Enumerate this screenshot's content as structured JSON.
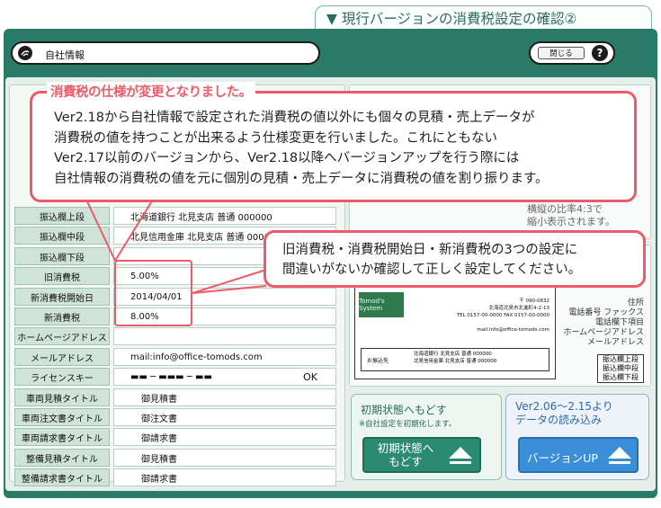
{
  "banner": {
    "title": "▼ 現行バージョンの消費税設定の確認②"
  },
  "window": {
    "title": "自社情報",
    "close_label": "閉じる",
    "help_label": "?"
  },
  "callout_top": {
    "heading": "消費税の仕様が変更となりました。",
    "body": [
      "Ver2.18から自社情報で設定された消費税の値以外にも個々の見積・売上データが",
      "消費税の値を持つことが出来るよう仕様変更を行いました。これにともない",
      "Ver2.17以前のバージョンから、Ver2.18以降へバージョンアップを行う際には",
      "自社情報の消費税の値を元に個別の見積・売上データに消費税の値を割り振ります。"
    ]
  },
  "callout_mid": {
    "body": [
      "旧消費税・消費税開始日・新消費税の3つの設定に",
      "間違いがないか確認して正しく設定してください。"
    ]
  },
  "preview_note": [
    "横縦の比率4:3で",
    "縮小表示されます。"
  ],
  "rows": [
    {
      "label": "振込欄上段",
      "value": "北海道銀行  北見支店  普通  000000"
    },
    {
      "label": "振込欄中段",
      "value": "北見信用金庫  北見支店  普通  000000"
    },
    {
      "label": "振込欄下段",
      "value": ""
    },
    {
      "label": "旧消費税",
      "value": "5.00%"
    },
    {
      "label": "新消費税開始日",
      "value": "2014/04/01"
    },
    {
      "label": "新消費税",
      "value": "8.00%"
    },
    {
      "label": "ホームページアドレス",
      "value": ""
    },
    {
      "label": "メールアドレス",
      "value": "mail:info@office-tomods.com"
    },
    {
      "label": "ライセンスキー",
      "value": "▬▬  ─  ▬▬▬  ─  ▬▬",
      "status": "OK"
    },
    {
      "label": "車両見積タイトル",
      "value": "御見積書"
    },
    {
      "label": "車両注文書タイトル",
      "value": "御注文書"
    },
    {
      "label": "車両請求書タイトル",
      "value": "御請求書"
    },
    {
      "label": "整備見積タイトル",
      "value": "御見積書"
    },
    {
      "label": "整備請求書タイトル",
      "value": "御請求書"
    }
  ],
  "preview": {
    "logo": "Tomod's System",
    "address_lines": [
      "〒 090-0832",
      "北海道北見市北進町4-2-13",
      "TEL 0157-00-0000  FAX 0157-00-0000",
      "mail:info@office-tomods.com"
    ],
    "bank_label": "お振込先",
    "bank_lines": [
      "北海道銀行  北見支店  普通  000000",
      "北見信用金庫  北見支店  普通  000000"
    ],
    "side_labels": [
      "住所",
      "電話番号  ファックス",
      "電話欄下項目",
      "ホームページアドレス",
      "メールアドレス"
    ],
    "bank_tags": [
      "振込欄上段",
      "振込欄中段",
      "振込欄下段"
    ]
  },
  "reset_panel": {
    "title": "初期状態へもどす",
    "note": "※自社設定を初期化します。",
    "button_line1": "初期状態へ",
    "button_line2": "もどす"
  },
  "upgrade_panel": {
    "title_line1": "Ver2.06～2.15より",
    "title_line2": "データの読み込み",
    "button": "バージョンUP"
  }
}
